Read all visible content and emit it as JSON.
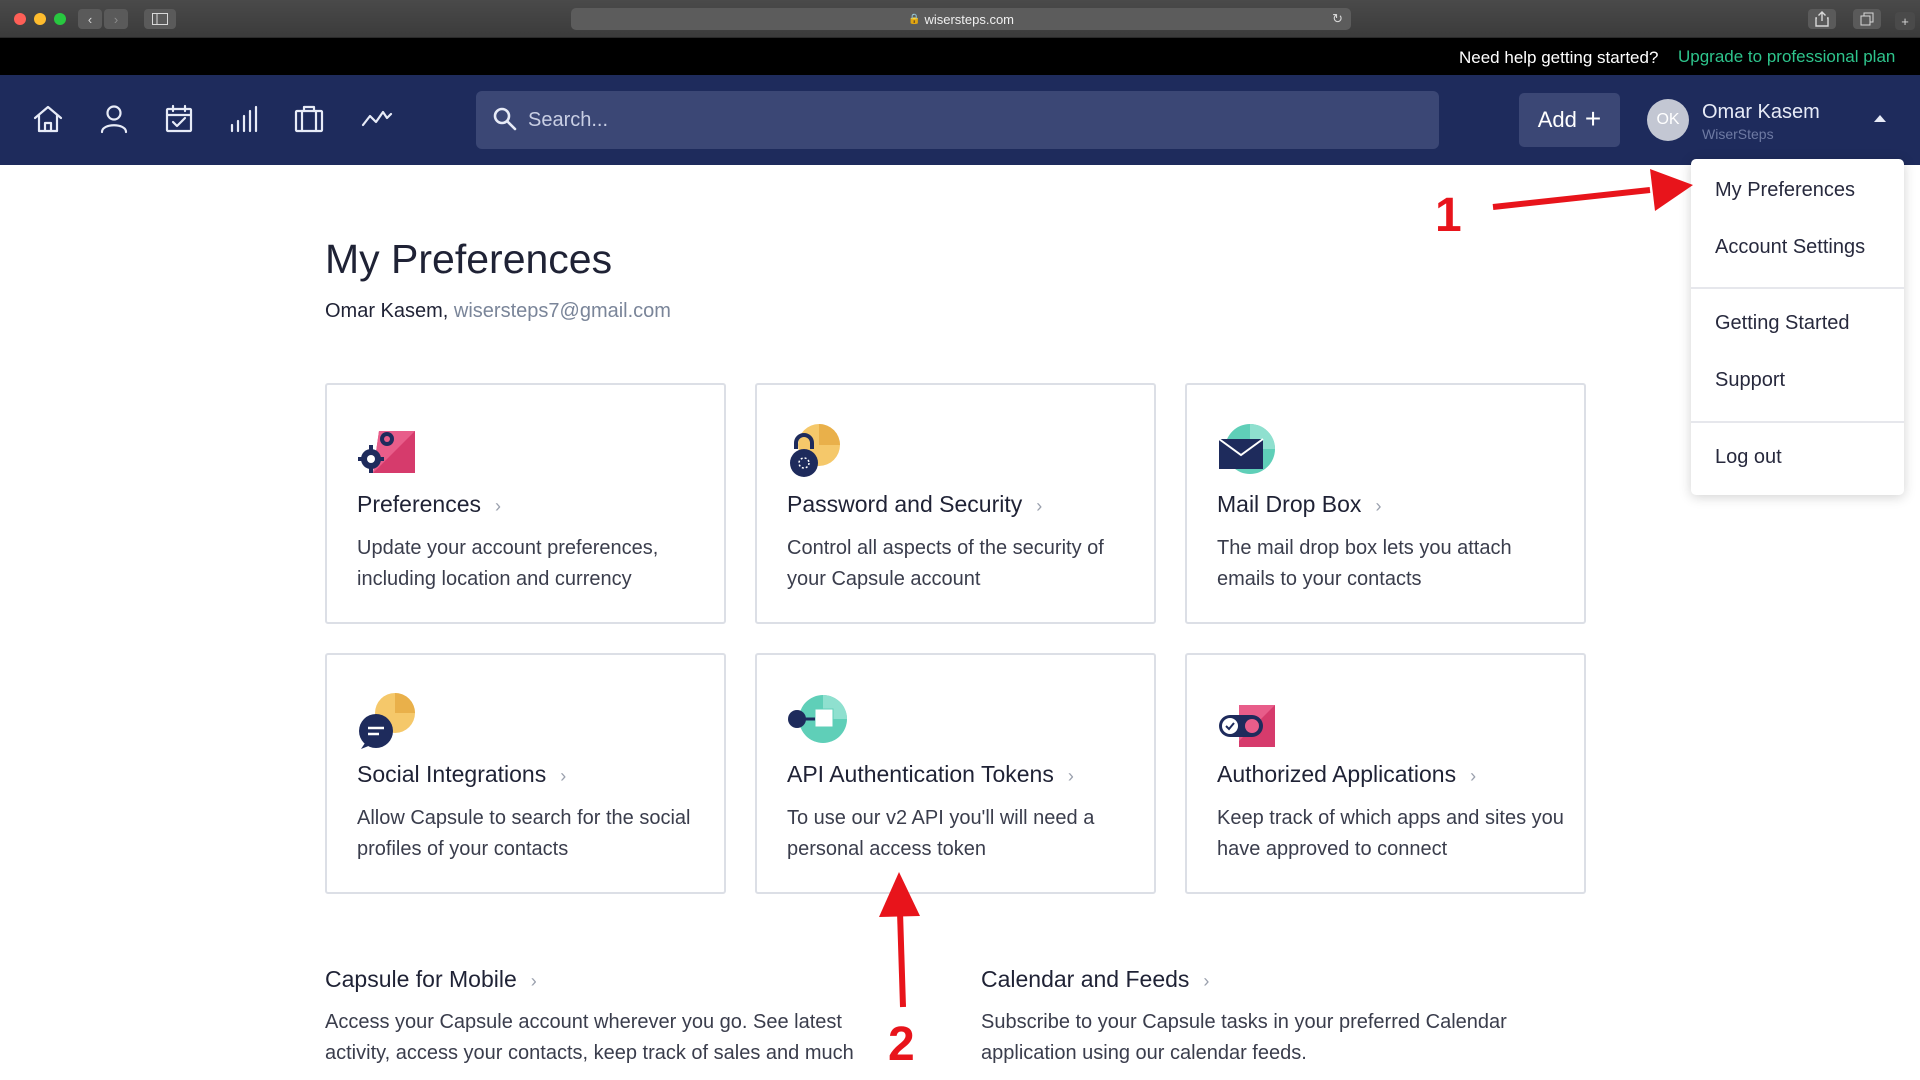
{
  "browser": {
    "url": "wisersteps.com",
    "lock_icon": "🔒"
  },
  "helpbar": {
    "help_text": "Need help getting started?",
    "upgrade_link": "Upgrade to professional plan"
  },
  "nav": {
    "icons": [
      "home-icon",
      "person-icon",
      "calendar-icon",
      "bar-chart-icon",
      "briefcase-icon",
      "trend-line-icon"
    ],
    "search_placeholder": "Search...",
    "add_label": "Add",
    "avatar_initials": "OK",
    "user_name": "Omar Kasem",
    "user_org": "WiserSteps"
  },
  "dropdown": {
    "items": [
      "My Preferences",
      "Account Settings",
      "Getting Started",
      "Support",
      "Log out"
    ]
  },
  "page": {
    "title": "My Preferences",
    "user_name": "Omar Kasem,",
    "email": "wisersteps7@gmail.com"
  },
  "cards": [
    {
      "title": "Preferences",
      "desc": "Update your account preferences, including location and currency"
    },
    {
      "title": "Password and Security",
      "desc": "Control all aspects of the security of your Capsule account"
    },
    {
      "title": "Mail Drop Box",
      "desc": "The mail drop box lets you attach emails to your contacts"
    },
    {
      "title": "Social Integrations",
      "desc": "Allow Capsule to search for the social profiles of your contacts"
    },
    {
      "title": "API Authentication Tokens",
      "desc": "To use our v2 API you'll will need a personal access token"
    },
    {
      "title": "Authorized Applications",
      "desc": "Keep track of which apps and sites you have approved to connect"
    }
  ],
  "sections": [
    {
      "title": "Capsule for Mobile",
      "desc": "Access your Capsule account wherever you go. See latest activity, access your contacts, keep track of sales and much"
    },
    {
      "title": "Calendar and Feeds",
      "desc": "Subscribe to your Capsule tasks in your preferred Calendar application using our calendar feeds."
    }
  ],
  "annotations": {
    "label_1": "1",
    "label_2": "2"
  },
  "colors": {
    "navbar": "#1e2b5c",
    "accent_green": "#2ec48c",
    "annotation_red": "#e8141b"
  }
}
